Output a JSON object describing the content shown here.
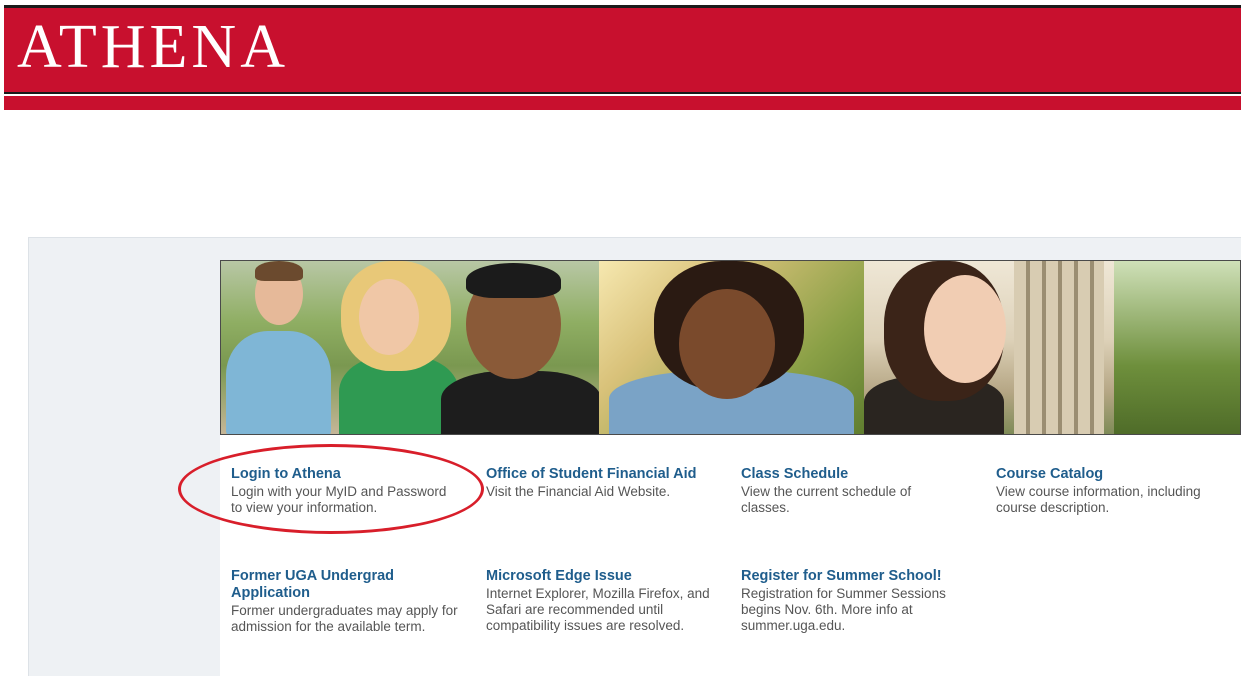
{
  "header": {
    "logo_text": "ATHENA",
    "brand_color": "#c8102e"
  },
  "banner": {
    "photos": [
      {
        "description": "students-group-photo"
      },
      {
        "description": "student-portrait-photo"
      },
      {
        "description": "student-campus-photo"
      }
    ]
  },
  "links": [
    {
      "title": "Login to Athena",
      "desc": "Login with your MyID and Password to view your information."
    },
    {
      "title": "Office of Student Financial Aid",
      "desc": "Visit the Financial Aid Website."
    },
    {
      "title": "Class Schedule",
      "desc": "View the current schedule of classes."
    },
    {
      "title": "Course Catalog",
      "desc": "View course information, including course description."
    },
    {
      "title": "Former UGA Undergrad Application",
      "desc": "Former undergraduates may apply for admission for the available term."
    },
    {
      "title": "Microsoft Edge Issue",
      "desc": "Internet Explorer, Mozilla Firefox, and Safari are recommended until compatibility issues are resolved."
    },
    {
      "title": "Register for Summer School!",
      "desc": "Registration for Summer Sessions begins Nov. 6th. More info at summer.uga.edu."
    }
  ],
  "annotation": {
    "circle_color": "#d81e2a"
  }
}
